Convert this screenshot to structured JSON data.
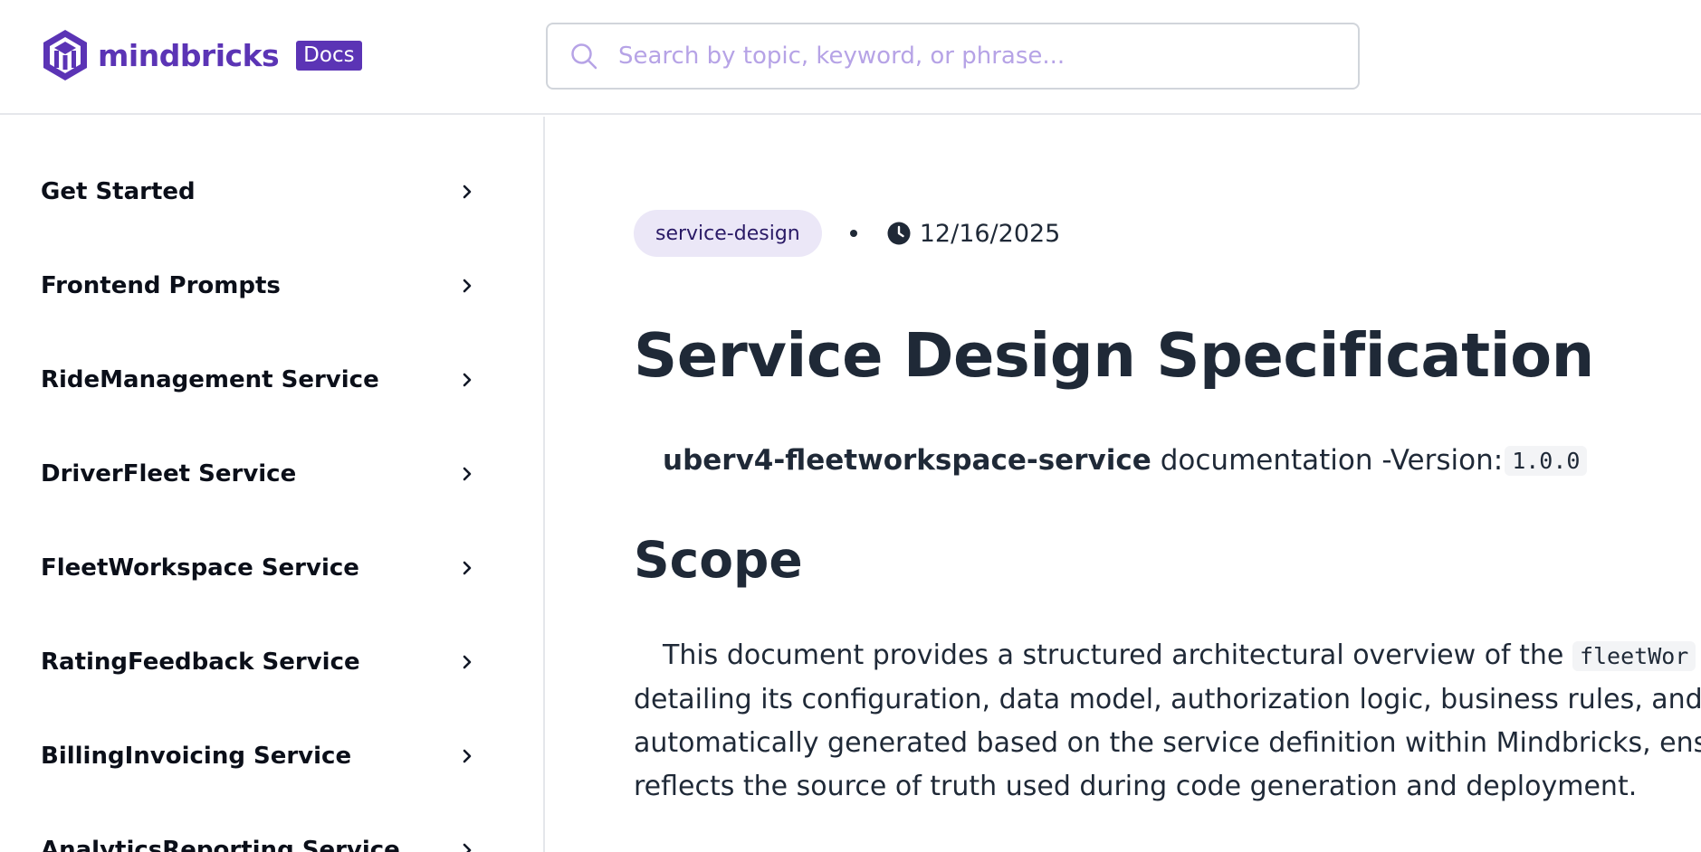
{
  "header": {
    "brand_name": "mindbricks",
    "docs_badge": "Docs",
    "search": {
      "placeholder": "Search by topic, keyword, or phrase..."
    },
    "brand_color": "#5b34b5"
  },
  "sidebar": {
    "items": [
      {
        "label": "Get Started"
      },
      {
        "label": "Frontend Prompts"
      },
      {
        "label": "RideManagement Service"
      },
      {
        "label": "DriverFleet Service"
      },
      {
        "label": "FleetWorkspace Service"
      },
      {
        "label": "RatingFeedback Service"
      },
      {
        "label": "BillingInvoicing Service"
      },
      {
        "label": "AnalyticsReporting Service"
      }
    ]
  },
  "main": {
    "tag": "service-design",
    "date": "12/16/2025",
    "title": "Service Design Specification",
    "subtitle": {
      "service_name": "uberv4-fleetworkspace-service",
      "text": "documentation -Version:",
      "version": "1.0.0"
    },
    "scope_heading": "Scope",
    "scope_paragraph": {
      "line1_text": "This document provides a structured architectural overview of the",
      "line1_code": "fleetWor",
      "line2": "detailing its configuration, data model, authorization logic, business rules, and",
      "line3": "automatically generated based on the service definition within Mindbricks, ens",
      "line4": "reflects the source of truth used during code generation and deployment."
    }
  }
}
